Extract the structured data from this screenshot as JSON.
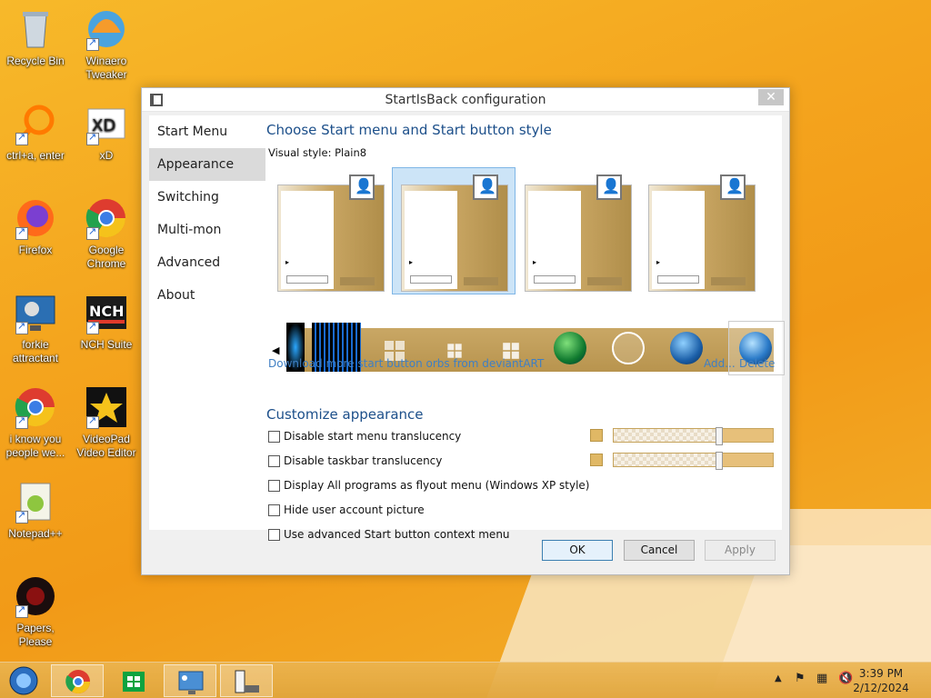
{
  "desktop": {
    "icons": [
      {
        "label": "Recycle Bin"
      },
      {
        "label": "Winaero Tweaker"
      },
      {
        "label": "ctrl+a, enter"
      },
      {
        "label": "xD"
      },
      {
        "label": "Firefox"
      },
      {
        "label": "Google Chrome"
      },
      {
        "label": "forkie attractant"
      },
      {
        "label": "NCH Suite"
      },
      {
        "label": "i know you people we..."
      },
      {
        "label": "VideoPad Video Editor"
      },
      {
        "label": "Notepad++"
      },
      {
        "label": "Papers, Please"
      }
    ]
  },
  "dialog": {
    "title": "StartIsBack configuration",
    "close_glyph": "✕",
    "nav": [
      {
        "label": "Start Menu"
      },
      {
        "label": "Appearance"
      },
      {
        "label": "Switching"
      },
      {
        "label": "Multi-mon"
      },
      {
        "label": "Advanced"
      },
      {
        "label": "About"
      }
    ],
    "active_nav": "Appearance",
    "heading": "Choose Start menu and Start button style",
    "visual_style_label": "Visual style:",
    "visual_style_value": "Plain8",
    "download_link": "Download more start button orbs from deviantART",
    "add_link": "Add...",
    "delete_link": "Delete",
    "customize_heading": "Customize appearance",
    "options": [
      {
        "label": "Disable start menu translucency",
        "checked": false
      },
      {
        "label": "Disable taskbar translucency",
        "checked": false
      },
      {
        "label": "Display All programs as flyout menu (Windows XP style)",
        "checked": false
      },
      {
        "label": "Hide user account picture",
        "checked": false
      },
      {
        "label": "Use advanced Start button context menu",
        "checked": false
      }
    ],
    "buttons": {
      "ok": "OK",
      "cancel": "Cancel",
      "apply": "Apply"
    }
  },
  "taskbar": {
    "clock_time": "3:39 PM",
    "clock_date": "2/12/2024"
  },
  "colors": {
    "accent": "#1c4f8a",
    "link": "#3f7fc4",
    "desktop": "#f4a51e"
  }
}
